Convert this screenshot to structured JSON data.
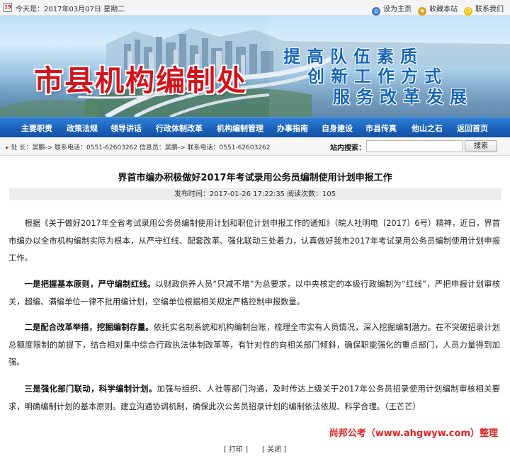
{
  "topbar": {
    "date_text": "今天是：2017年03月07日  星期二",
    "calendar_icon_text": "15",
    "links": [
      "设为主页",
      "收藏本站",
      "联系我们"
    ]
  },
  "banner": {
    "title": "市县机构编制处",
    "slogans": [
      "提高队伍素质",
      "创新工作方式",
      "服务改革发展"
    ]
  },
  "nav": {
    "items": [
      "主要职责",
      "政策法规",
      "领导讲话",
      "行政体制改革",
      "机构编制管理",
      "办事指南",
      "自身建设",
      "市县传真",
      "他山之石",
      "返回首页"
    ]
  },
  "infobar": {
    "info_text": "处 长：吴鹏-> 联系电话：0551-62603262     信息员：吴鹏-> 联系电话：0551-62603262",
    "search_label": "站内搜索：",
    "search_value": "",
    "search_button": "搜索"
  },
  "article": {
    "title": "界首市编办积极做好2017年考试录用公务员编制使用计划申报工作",
    "meta_publish": "发布时间：2017-01-26 17:22:35",
    "meta_views": "阅读次数：105",
    "p1": "根据《关于做好2017年全省考试录用公务员编制使用计划和职位计划申报工作的通知》（皖人社明电〔2017〕6号）精神，近日，界首市编办以全市机构编制实际为根本，从严守红线、配套改革、强化联动三处着力，认真做好我市2017年考试录用公务员编制使用计划申报工作。",
    "p2_lead": "一是把握基本原则，严守编制红线。",
    "p2_text": "以财政供养人员“只减不增”为总要求，以中央核定的本级行政编制为“红线”，严把申报计划审核关，超编、满编单位一律不批用编计划，空编单位根据相关规定严格控制申报数量。",
    "p3_lead": "二是配合改革举措，挖掘编制存量。",
    "p3_text": "依托实名制系统和机构编制台账，梳理全市实有人员情况，深入挖掘编制潜力。在不突破招录计划总额度限制的前提下，结合相对集中综合行政执法体制改革等，有针对性的向相关部门倾斜，确保职能强化的重点部门，人员力量得到加强。",
    "p4_lead": "三是强化部门联动，科学编制计划。",
    "p4_text": "加强与组织、人社等部门沟通，及时传达上级关于2017年公务员招录使用计划编制审核相关要求，明确编制计划的基本原则。建立沟通协调机制，确保此次公务员招录计划的编制依法依规、科学合理。（王芒芒）",
    "credit": "尚邦公考（www.ahgwyw.com）整理",
    "print_label": "[ 打印 ]",
    "close_label": "[ 关闭 ]"
  },
  "colors": {
    "nav_blue": "#1b62bb",
    "title_red": "#d2141d",
    "slogan_blue": "#1566b8",
    "credit_red": "#e02222"
  }
}
